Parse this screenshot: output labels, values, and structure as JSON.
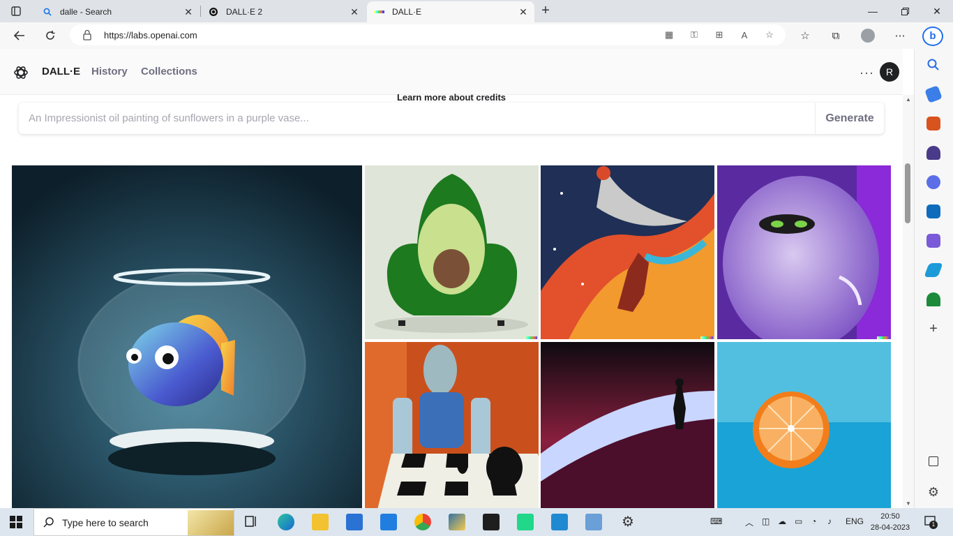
{
  "tabs": [
    {
      "title": "dalle - Search"
    },
    {
      "title": "DALL·E 2"
    },
    {
      "title": "DALL·E"
    }
  ],
  "address_bar": {
    "url": "https://labs.openai.com"
  },
  "app": {
    "brand": "DALL·E",
    "nav": [
      {
        "label": "History"
      },
      {
        "label": "Collections"
      }
    ],
    "user_initial": "R"
  },
  "credits_text": "Learn more about credits",
  "prompt": {
    "placeholder": "An Impressionist oil painting of sunflowers in a purple vase...",
    "generate_label": "Generate"
  },
  "gallery": {
    "images": [
      {
        "subject": "goldfish-bowl",
        "color": "#16303d"
      },
      {
        "subject": "avocado-armchair",
        "color": "#dfe5d8"
      },
      {
        "subject": "space-basketball",
        "color": "#1f2f55"
      },
      {
        "subject": "purple-monster",
        "color": "#5a2aa0"
      },
      {
        "subject": "robot-chess",
        "color": "#c9501c"
      },
      {
        "subject": "desert-wanderer",
        "color": "#26101c"
      },
      {
        "subject": "orange-half",
        "color": "#52bfe0"
      }
    ]
  },
  "taskbar": {
    "search_placeholder": "Type here to search",
    "language": "ENG",
    "time": "20:50",
    "date": "28-04-2023",
    "notifications": "1"
  }
}
